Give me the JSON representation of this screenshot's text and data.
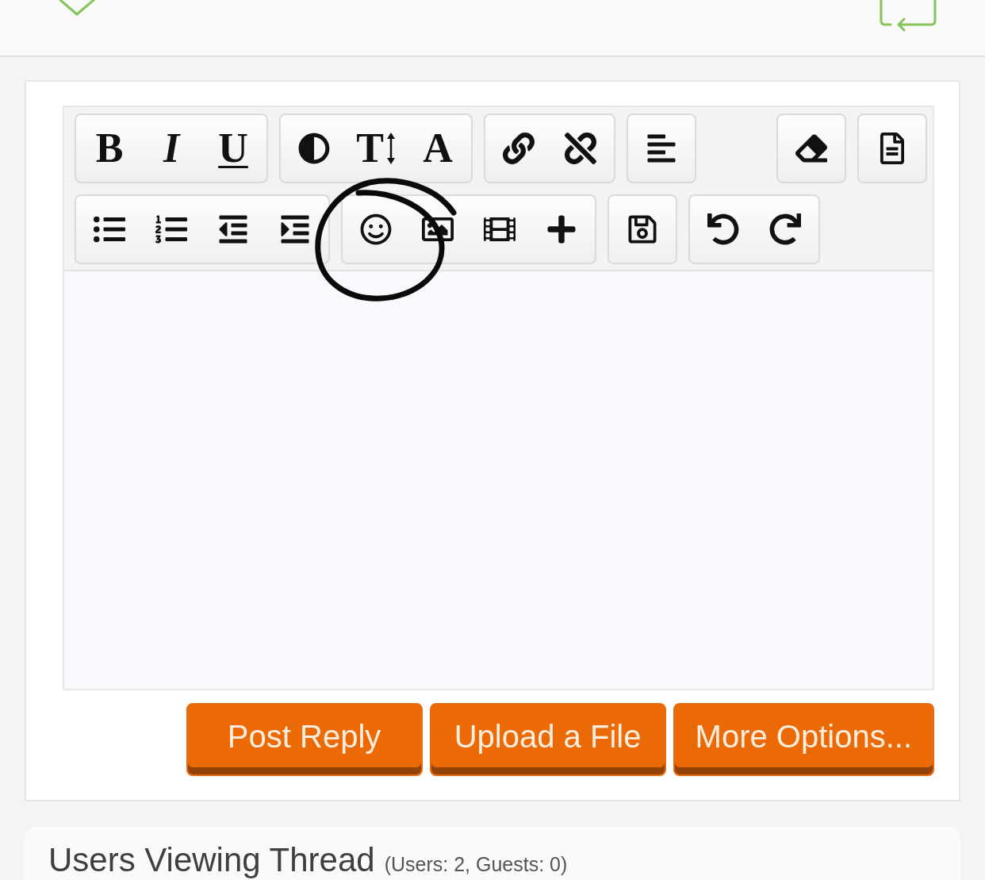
{
  "editor": {
    "toolbar": {
      "rows": [
        {
          "groups": [
            {
              "buttons": [
                {
                  "kind": "bold",
                  "label": "B"
                },
                {
                  "kind": "italic",
                  "label": "I"
                },
                {
                  "kind": "underline",
                  "label": "U"
                }
              ]
            },
            {
              "buttons": [
                {
                  "kind": "contrast"
                },
                {
                  "kind": "text-size",
                  "label": "T"
                },
                {
                  "kind": "font-color",
                  "label": "A"
                }
              ]
            },
            {
              "buttons": [
                {
                  "kind": "link"
                },
                {
                  "kind": "unlink"
                }
              ]
            },
            {
              "buttons": [
                {
                  "kind": "align"
                }
              ]
            }
          ],
          "end_groups": [
            {
              "buttons": [
                {
                  "kind": "eraser"
                }
              ]
            },
            {
              "buttons": [
                {
                  "kind": "document"
                }
              ]
            }
          ]
        },
        {
          "groups": [
            {
              "buttons": [
                {
                  "kind": "bullet-list"
                },
                {
                  "kind": "numbered-list"
                },
                {
                  "kind": "outdent"
                },
                {
                  "kind": "indent"
                }
              ]
            },
            {
              "buttons": [
                {
                  "kind": "smiley"
                },
                {
                  "kind": "image"
                },
                {
                  "kind": "film"
                },
                {
                  "kind": "plus"
                }
              ]
            },
            {
              "buttons": [
                {
                  "kind": "save"
                }
              ]
            },
            {
              "buttons": [
                {
                  "kind": "undo"
                },
                {
                  "kind": "redo"
                }
              ]
            }
          ]
        }
      ]
    }
  },
  "actions": [
    {
      "label": "Post Reply"
    },
    {
      "label": "Upload a File"
    },
    {
      "label": "More Options..."
    }
  ],
  "viewers": {
    "title": "Users Viewing Thread",
    "count": "(Users: 2, Guests: 0)"
  }
}
